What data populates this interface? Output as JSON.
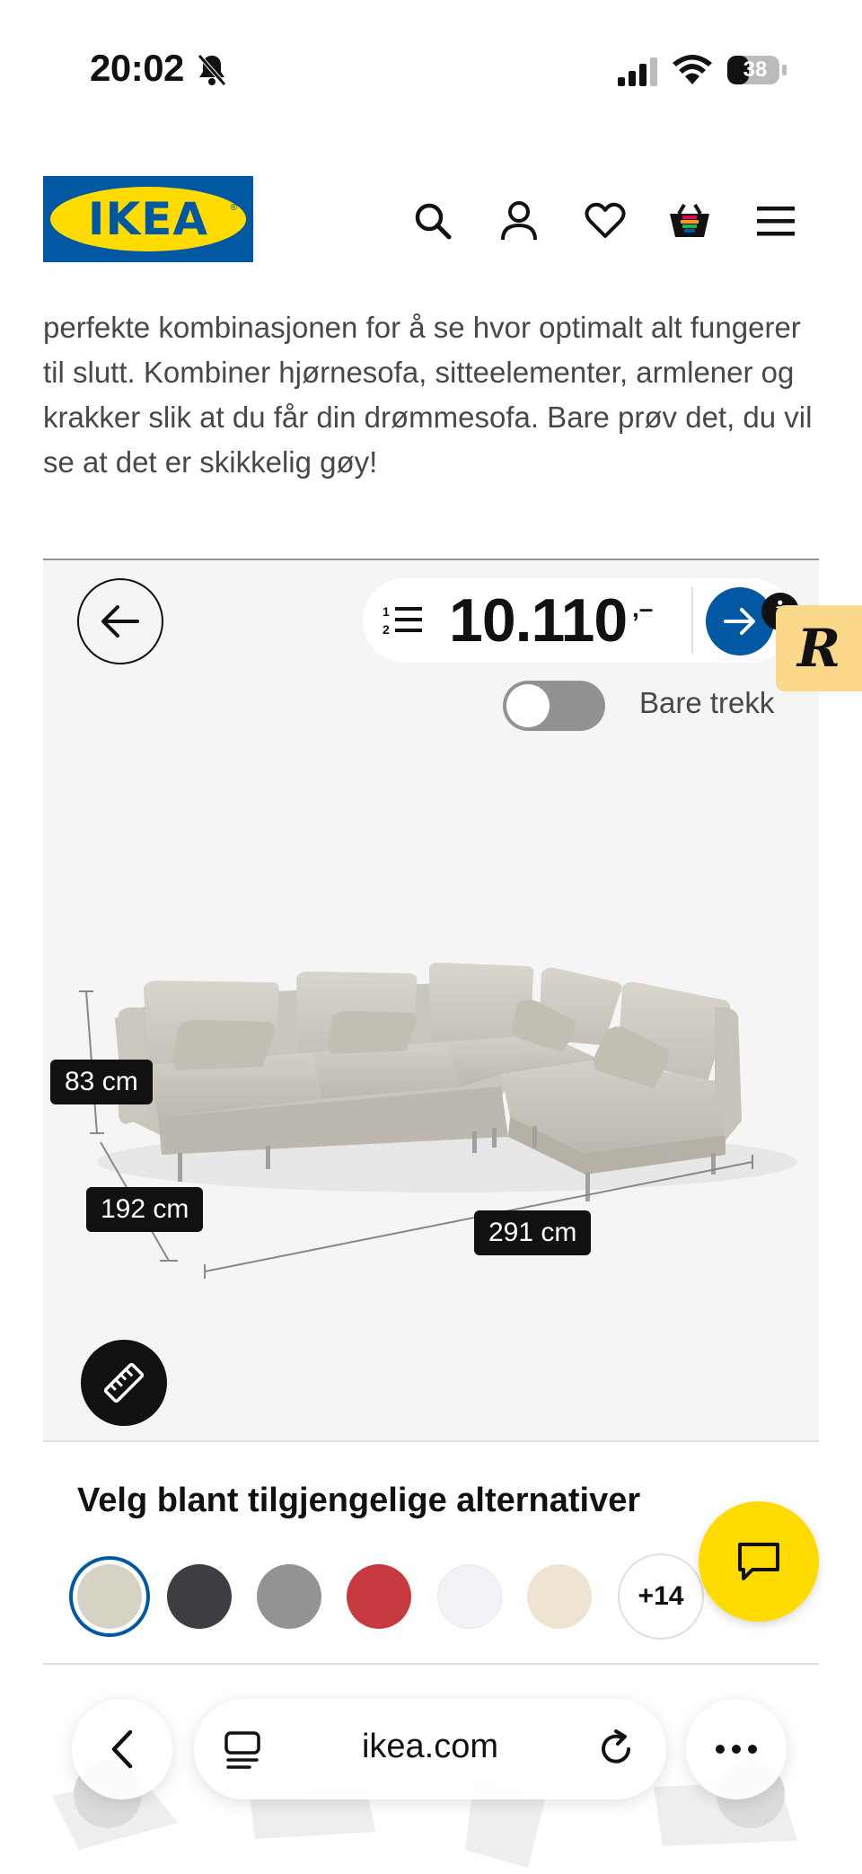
{
  "status_bar": {
    "time": "20:02",
    "battery": "38"
  },
  "header": {
    "logo_text": "IKEA",
    "icons": [
      "search-icon",
      "account-icon",
      "heart-icon",
      "basket-icon",
      "menu-icon"
    ]
  },
  "intro": {
    "text": "perfekte kombinasjonen for å se hvor optimalt alt fungerer til slutt. Kombiner hjørnesofa, sitteelementer, armlener og krakker slik at du får din drømmesofa. Bare prøv det, du vil se at det er skikkelig gøy!"
  },
  "configurator": {
    "price": "10.110",
    "price_suffix": ",–",
    "info_badge": "i",
    "r_badge": "R",
    "toggle_label": "Bare trekk",
    "toggle_on": false,
    "dimensions": {
      "height": "83 cm",
      "depth": "192 cm",
      "width": "291 cm"
    }
  },
  "alternatives": {
    "title": "Velg blant tilgjengelige alternativer",
    "swatches": [
      {
        "color": "#d6d3c5",
        "selected": true
      },
      {
        "color": "#3d3d42",
        "selected": false
      },
      {
        "color": "#939393",
        "selected": false
      },
      {
        "color": "#c73a3f",
        "selected": false
      },
      {
        "color": "#f1f3f7",
        "selected": false
      },
      {
        "color": "#efe4d2",
        "selected": false
      }
    ],
    "more_label": "+14"
  },
  "browser": {
    "url": "ikea.com"
  },
  "colors": {
    "ikea_blue": "#0058a3",
    "ikea_yellow": "#ffdb00"
  }
}
